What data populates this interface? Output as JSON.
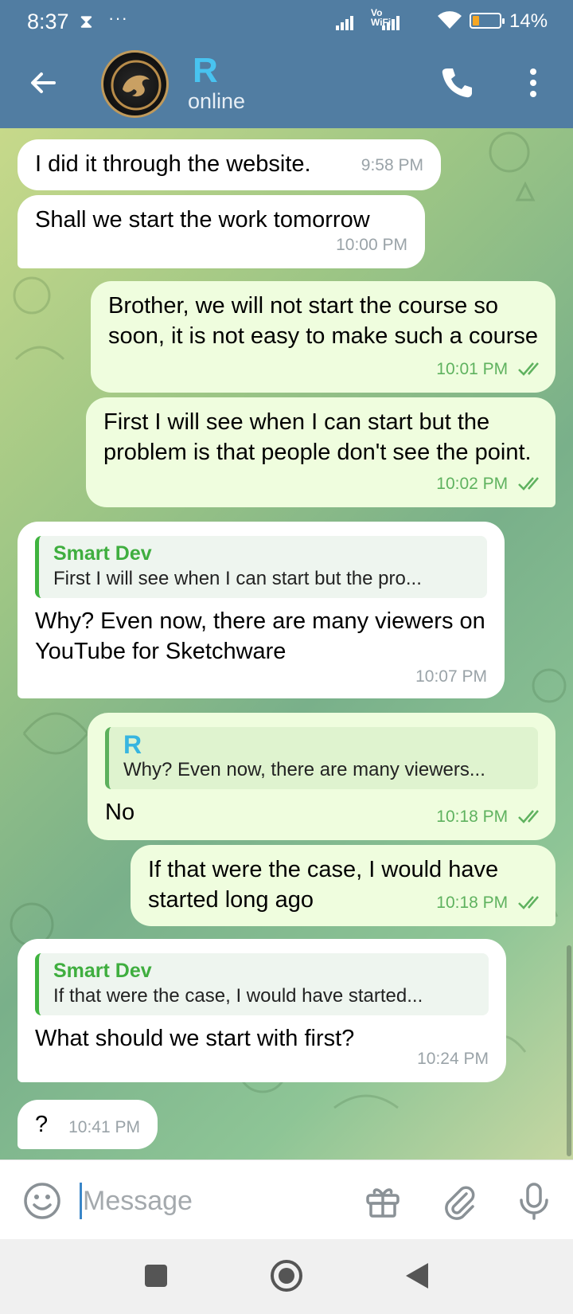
{
  "status_bar": {
    "time": "8:37",
    "hourglass": "⧗",
    "dots": "···",
    "network": "Vo WiFi",
    "battery_percent": "14%"
  },
  "header": {
    "contact_name": "R",
    "contact_status": "online"
  },
  "messages": [
    {
      "direction": "in",
      "text": "I did it through the website.",
      "time": "9:58 PM"
    },
    {
      "direction": "in",
      "text": "Shall we start the work tomorrow",
      "time": "10:00 PM"
    },
    {
      "direction": "out",
      "text": "Brother, we will not start the course so soon, it is not easy to make such a course",
      "time": "10:01 PM",
      "read": true
    },
    {
      "direction": "out",
      "text": "First I will see when I can start but the problem is that people don't see the point.",
      "time": "10:02 PM",
      "read": true
    },
    {
      "direction": "in",
      "reply_to": {
        "author": "Smart Dev",
        "text": "First I will see when I can start but the pro..."
      },
      "text": "Why? Even now, there are many viewers on YouTube for Sketchware",
      "time": "10:07 PM"
    },
    {
      "direction": "out",
      "reply_to": {
        "author": "R",
        "text": "Why? Even now, there are many viewers..."
      },
      "text": "No",
      "time": "10:18 PM",
      "read": true
    },
    {
      "direction": "out",
      "text": "If that were the case, I would have started long ago",
      "time": "10:18 PM",
      "read": true
    },
    {
      "direction": "in",
      "reply_to": {
        "author": "Smart Dev",
        "text": "If that were the case, I would have started..."
      },
      "text": "What should we start with first?",
      "time": "10:24 PM"
    },
    {
      "direction": "in",
      "text": "?",
      "time": "10:41 PM"
    }
  ],
  "input": {
    "placeholder": "Message",
    "value": ""
  },
  "colors": {
    "header": "#517da2",
    "incoming_bubble": "#ffffff",
    "outgoing_bubble": "#effdde",
    "accent_green": "#3fae3f",
    "name_blue": "#48c3f0"
  },
  "icons": [
    "back-arrow-icon",
    "phone-icon",
    "more-vert-icon",
    "emoji-icon",
    "gift-icon",
    "attach-icon",
    "mic-icon",
    "nav-recents-icon",
    "nav-home-icon",
    "nav-back-icon"
  ]
}
